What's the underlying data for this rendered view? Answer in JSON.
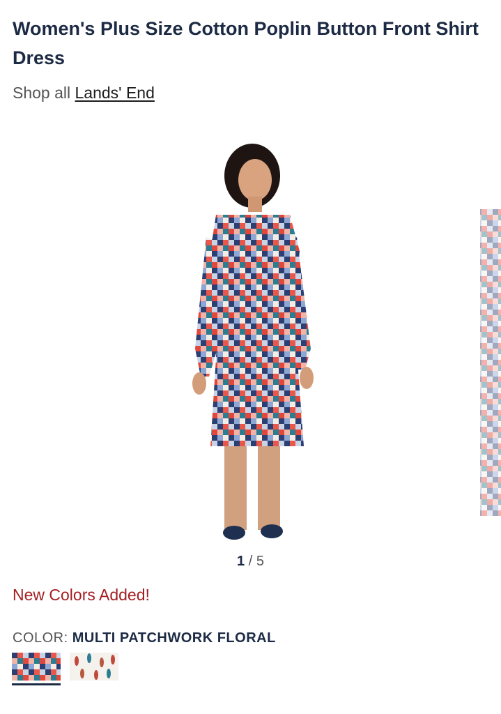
{
  "product": {
    "title": "Women's Plus Size Cotton Poplin Button Front Shirt Dress",
    "shop_prefix": "Shop all",
    "brand": "Lands' End"
  },
  "gallery": {
    "current": "1",
    "separator": "/",
    "total": "5"
  },
  "promo": {
    "text": "New Colors Added!",
    "color": "#a31e22"
  },
  "color_selector": {
    "label": "COLOR:",
    "selected": "MULTI PATCHWORK FLORAL",
    "swatches": [
      "multi-patchwork-floral",
      "feather-print"
    ]
  },
  "colors": {
    "title": "#1c2a44",
    "promo": "#a31e22"
  }
}
